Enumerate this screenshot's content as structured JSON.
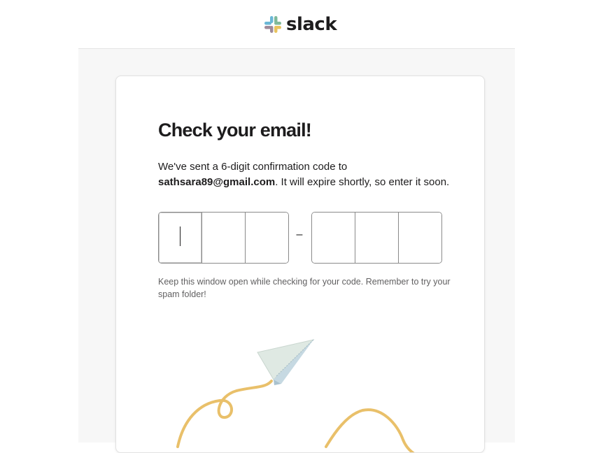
{
  "brand": {
    "name": "slack",
    "logo_icon": "slack-hash-icon",
    "colors": {
      "blue": "#36c5f0",
      "green": "#2eb67d",
      "yellow": "#ecb22e",
      "red": "#e01e5a",
      "text": "#1d1c1d"
    }
  },
  "card": {
    "title": "Check your email!",
    "intro_prefix": "We've sent a 6-digit confirmation code to",
    "email": "sathsara89@gmail.com",
    "intro_suffix": ". It will expire shortly, so enter it soon.",
    "code": {
      "separator": "–",
      "digits": [
        "",
        "",
        "",
        "",
        "",
        ""
      ]
    },
    "hint": "Keep this window open while checking for your code. Remember to try your spam folder!"
  },
  "illustration": {
    "icon": "paper-plane-icon",
    "trail_color": "#ecb22e"
  }
}
